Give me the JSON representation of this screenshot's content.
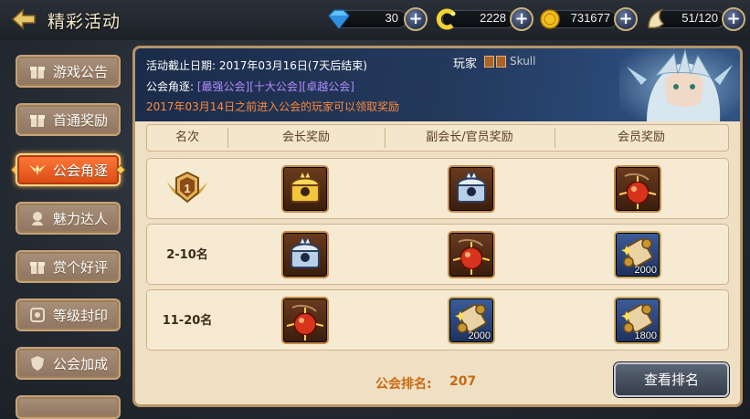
{
  "header": {
    "title": "精彩活动",
    "resources": [
      {
        "icon": "diamond-icon",
        "value": "30"
      },
      {
        "icon": "energy-icon",
        "value": "2228"
      },
      {
        "icon": "gold-coin-icon",
        "value": "731677"
      },
      {
        "icon": "stamina-icon",
        "value": "51/120"
      }
    ],
    "plus_label": "+"
  },
  "sidebar": {
    "items": [
      {
        "label": "游戏公告",
        "icon": "gift-icon",
        "active": false
      },
      {
        "label": "首通奖励",
        "icon": "gift-icon",
        "active": false
      },
      {
        "label": "公会角逐",
        "icon": "guild-wings-icon",
        "active": true
      },
      {
        "label": "魅力达人",
        "icon": "charm-icon",
        "active": false
      },
      {
        "label": "赏个好评",
        "icon": "gift-icon",
        "active": false
      },
      {
        "label": "等级封印",
        "icon": "seal-icon",
        "active": false
      },
      {
        "label": "公会加成",
        "icon": "shield-icon",
        "active": false
      }
    ]
  },
  "banner": {
    "deadline": "活动截止日期: 2017年03月16日(7天后结束)",
    "competition_label": "公会角逐:",
    "competition_tags": [
      "[最强公会]",
      "[十大公会]",
      "[卓越公会]"
    ],
    "note": "2017年03月14日之前进入公会的玩家可以领取奖励",
    "player_label": "玩家",
    "player_name": "Skull"
  },
  "table": {
    "headers": [
      "名次",
      "会长奖励",
      "副会长/官员奖励",
      "会员奖励"
    ],
    "rows": [
      {
        "rank": "",
        "rank_icon": "rank-1-medal-icon",
        "rewards": [
          {
            "icon": "gold-chest-icon",
            "style": "brown",
            "qty": ""
          },
          {
            "icon": "silver-chest-icon",
            "style": "brown",
            "qty": ""
          },
          {
            "icon": "red-orb-icon",
            "style": "brown",
            "qty": ""
          }
        ]
      },
      {
        "rank": "2-10名",
        "rank_icon": "",
        "rewards": [
          {
            "icon": "silver-chest-icon",
            "style": "brown",
            "qty": ""
          },
          {
            "icon": "red-orb-icon",
            "style": "brown",
            "qty": ""
          },
          {
            "icon": "scroll-icon",
            "style": "blue",
            "qty": "2000"
          }
        ]
      },
      {
        "rank": "11-20名",
        "rank_icon": "",
        "rewards": [
          {
            "icon": "red-orb-icon",
            "style": "brown",
            "qty": ""
          },
          {
            "icon": "scroll-icon",
            "style": "blue",
            "qty": "2000"
          },
          {
            "icon": "scroll-icon",
            "style": "blue",
            "qty": "1800"
          }
        ]
      }
    ]
  },
  "footer": {
    "rank_label": "公会排名:",
    "rank_value": "207",
    "view_button": "查看排名"
  }
}
